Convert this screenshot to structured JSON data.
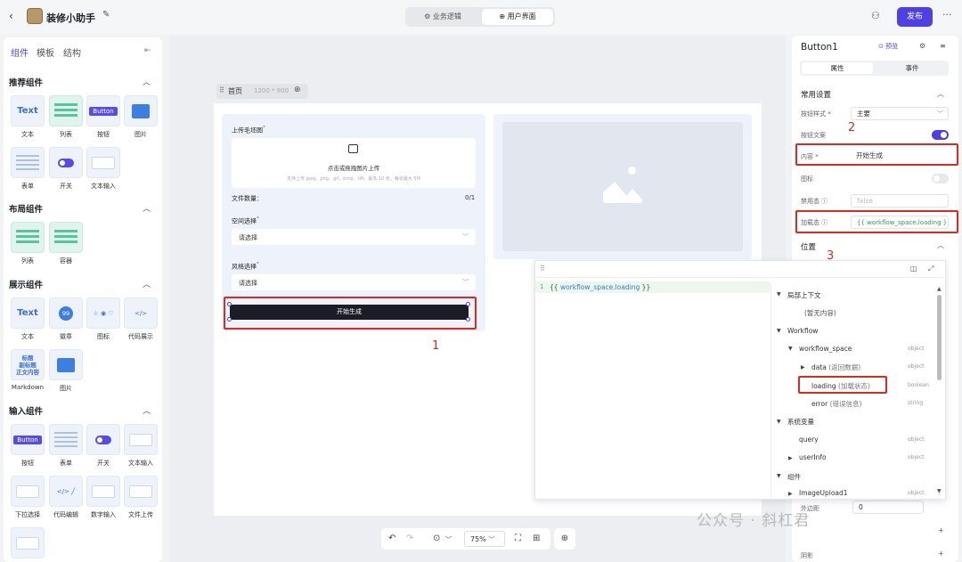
{
  "topbar": {
    "back": "‹",
    "app_title": "装修小助手",
    "tab_logic": "⚙ 业务逻辑",
    "tab_ui": "⊕ 用户界面",
    "publish": "发布",
    "more": "···"
  },
  "left": {
    "tabs": [
      "组件",
      "模板",
      "结构"
    ],
    "sections": {
      "recommended": "推荐组件",
      "layout": "布局组件",
      "display": "展示组件",
      "input": "输入组件"
    },
    "recommended": [
      "文本",
      "列表",
      "按钮",
      "图片",
      "表单",
      "开关",
      "文本输入"
    ],
    "layout": [
      "列表",
      "容器"
    ],
    "display": [
      "文本",
      "徽章",
      "图标",
      "代码展示",
      "Markdown",
      "图片"
    ],
    "input": [
      "按钮",
      "表单",
      "开关",
      "文本输入",
      "下拉选择",
      "代码编辑",
      "数字输入",
      "文件上传"
    ],
    "thumb": {
      "text": "Text",
      "button": "Button",
      "badge": "99",
      "md": "标题\n副标题\n正文内容"
    }
  },
  "canvas": {
    "page_name": "首页",
    "page_size": "1200 * 900",
    "upload_label": "上传毛坯图",
    "upload_req": "*",
    "upload_text": "点击或拖拽图片上传",
    "upload_hint": "支持上传 jpeg、png、gif、bmp、tiff，最多 10 张，每张最大 5M",
    "count_label": "文件数量：",
    "count_value": "0/1",
    "space_label": "空间选择",
    "style_label": "风格选择",
    "placeholder": "请选择",
    "gen_button": "开始生成",
    "zoom": "75%"
  },
  "annotations": {
    "n1": "1",
    "n2": "2",
    "n3": "3"
  },
  "right": {
    "title": "Button1",
    "preview": "⊙ 预览",
    "tab_props": "属性",
    "tab_events": "事件",
    "common": "常用设置",
    "btn_style_label": "按钮样式",
    "btn_style_value": "主要",
    "btn_text_label": "按钮文案",
    "btn_text_on": true,
    "content_label": "内容",
    "content_value": "开始生成",
    "icon_label": "图标",
    "icon_on": false,
    "disabled_label": "禁用态",
    "disabled_value": "false",
    "loading_label": "加载态",
    "loading_value": "{{ workflow_space.loading }}",
    "position": "位置",
    "margin": "外边距",
    "margin_value": "0",
    "appearance": "阴影"
  },
  "editor": {
    "line_no": "1",
    "code_open": "{{ ",
    "code_var": "workflow_space.loading",
    "code_close": " }}",
    "tree": [
      {
        "label": "局部上下文",
        "kind": "group"
      },
      {
        "label": "(暂无内容)",
        "kind": "item"
      },
      {
        "label": "Workflow",
        "kind": "group"
      },
      {
        "label": "workflow_space",
        "type": "object"
      },
      {
        "label": "data",
        "note": "(返回数据)",
        "type": "object"
      },
      {
        "label": "loading",
        "note": "(加载状态)",
        "type": "boolean"
      },
      {
        "label": "error",
        "note": "(错误信息)",
        "type": "string"
      },
      {
        "label": "系统变量",
        "kind": "group"
      },
      {
        "label": "query",
        "type": "object"
      },
      {
        "label": "userInfo",
        "type": "object"
      },
      {
        "label": "组件",
        "kind": "group"
      },
      {
        "label": "ImageUpload1",
        "type": "object"
      }
    ]
  },
  "watermark": "公众号 · 斜杠君",
  "colors": {
    "accent": "#4e40e5",
    "annotation": "#e0281c",
    "button_dark": "#1b1c24"
  }
}
